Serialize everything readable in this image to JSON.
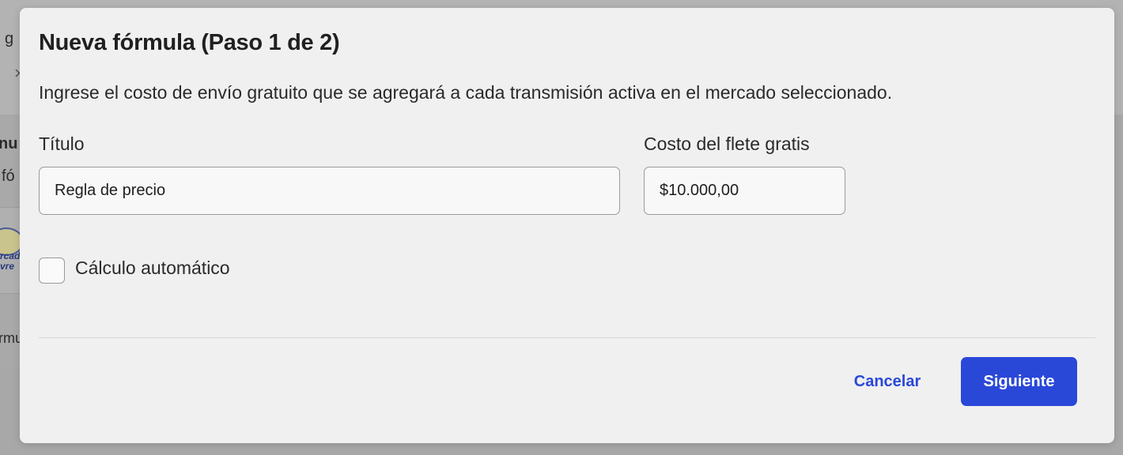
{
  "background": {
    "fragments": [
      "g",
      "nu",
      "fó",
      "rcad",
      "vre",
      "rmu"
    ]
  },
  "modal": {
    "title": "Nueva fórmula (Paso 1 de 2)",
    "description": "Ingrese el costo de envío gratuito que se agregará a cada transmisión activa en el mercado seleccionado.",
    "fields": {
      "title_label": "Título",
      "title_value": "Regla de precio",
      "shipping_label": "Costo del flete gratis",
      "shipping_value": "$10.000,00"
    },
    "auto_calc": {
      "label": "Cálculo automático",
      "checked": false
    },
    "buttons": {
      "cancel": "Cancelar",
      "next": "Siguiente"
    }
  },
  "colors": {
    "accent": "#2a48d8",
    "overlay": "#a8a8a8",
    "modal_bg": "#f0f0f0"
  }
}
